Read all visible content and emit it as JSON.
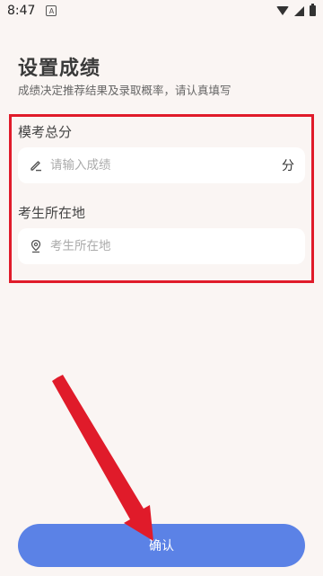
{
  "status_bar": {
    "time": "8:47",
    "notif_glyph": "A"
  },
  "page": {
    "title": "设置成绩",
    "subtitle": "成绩决定推荐结果及录取概率，请认真填写"
  },
  "score_section": {
    "label": "模考总分",
    "placeholder": "请输入成绩",
    "value": "",
    "unit": "分",
    "icon": "pencil-icon"
  },
  "location_section": {
    "label": "考生所在地",
    "placeholder": "考生所在地",
    "value": "",
    "icon": "location-pin-icon"
  },
  "confirm_button": {
    "label": "确认"
  },
  "colors": {
    "background": "#faf5f3",
    "accent": "#5b82e6",
    "highlight_frame": "#e01b2a"
  }
}
